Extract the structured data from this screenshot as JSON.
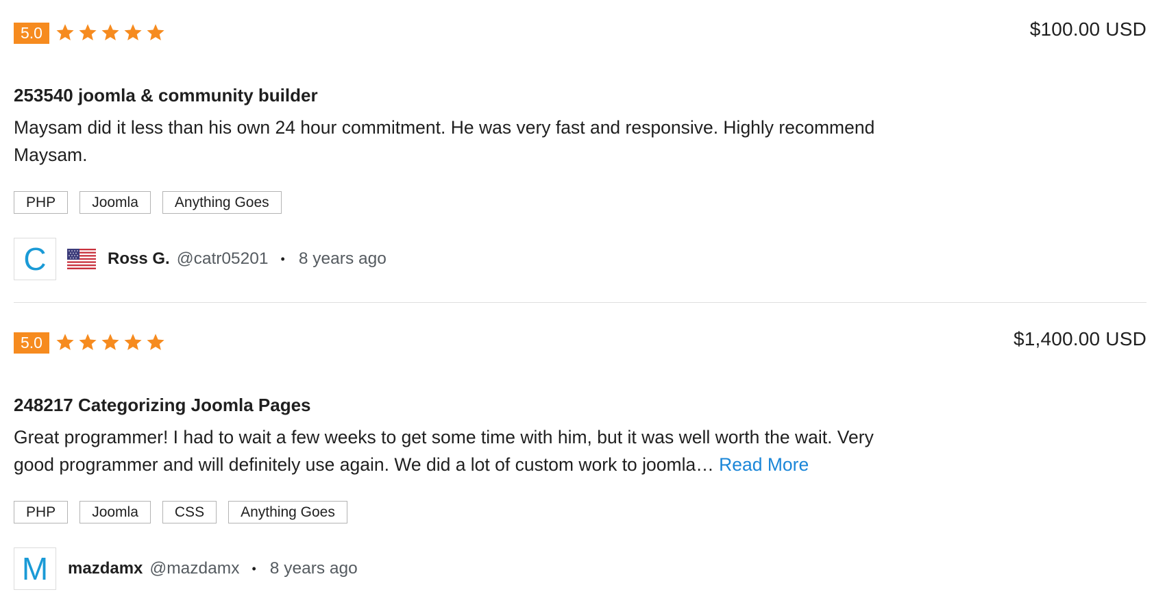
{
  "colors": {
    "rating_badge": "#f68b1f",
    "star": "#f68b1f",
    "link": "#1a86d8",
    "avatar_letter": "#1a9ad6"
  },
  "reviews": [
    {
      "rating": "5.0",
      "stars": 5,
      "price": "$100.00 USD",
      "title": "253540 joomla & community builder",
      "description": "Maysam did it less than his own 24 hour commitment. He was very fast and responsive. Highly recommend Maysam.",
      "read_more": "",
      "tags": [
        "PHP",
        "Joomla",
        "Anything Goes"
      ],
      "author": {
        "avatar_letter": "C",
        "flag": "us-flag-icon",
        "name": "Ross G.",
        "handle": "@catr05201",
        "separator": "•",
        "time": "8 years ago"
      }
    },
    {
      "rating": "5.0",
      "stars": 5,
      "price": "$1,400.00 USD",
      "title": "248217 Categorizing Joomla Pages",
      "description": "Great programmer! I had to wait a few weeks to get some time with him, but it was well worth the wait. Very good programmer and will definitely use again. We did a lot of custom work to joomla…",
      "read_more": "Read More",
      "tags": [
        "PHP",
        "Joomla",
        "CSS",
        "Anything Goes"
      ],
      "author": {
        "avatar_letter": "M",
        "name": "mazdamx",
        "handle": "@mazdamx",
        "separator": "•",
        "time": "8 years ago"
      }
    }
  ]
}
